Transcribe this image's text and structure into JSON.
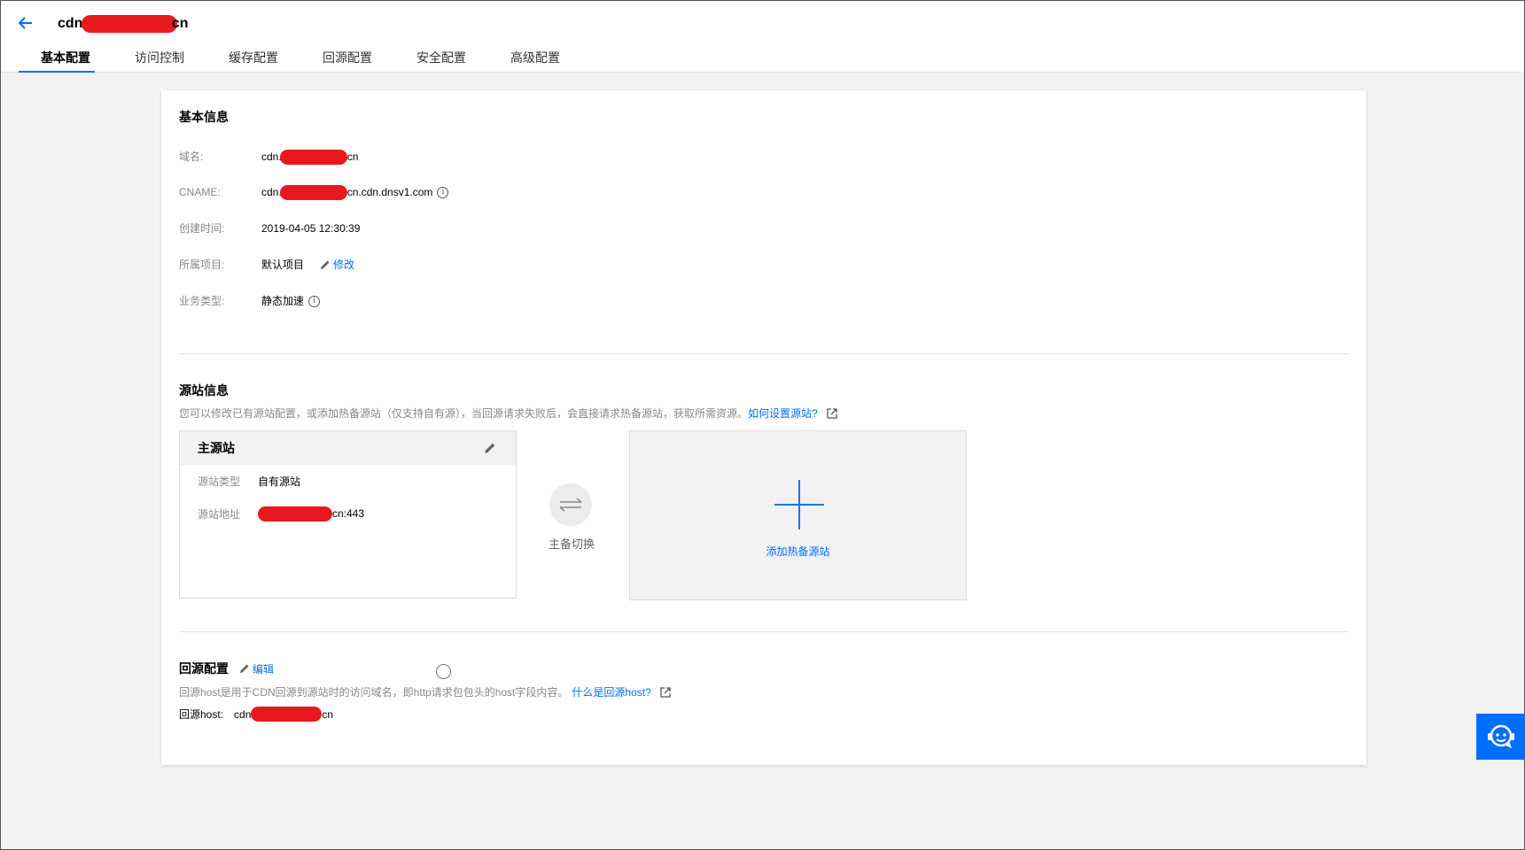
{
  "header": {
    "domain_prefix": "cdn.",
    "domain_suffix": "cn"
  },
  "tabs": [
    {
      "label": "基本配置",
      "active": true
    },
    {
      "label": "访问控制"
    },
    {
      "label": "缓存配置"
    },
    {
      "label": "回源配置"
    },
    {
      "label": "安全配置"
    },
    {
      "label": "高级配置"
    }
  ],
  "basic_info": {
    "title": "基本信息",
    "domain_label": "域名:",
    "domain_prefix": "cdn.",
    "domain_suffix": "cn",
    "cname_label": "CNAME:",
    "cname_prefix": "cdn.",
    "cname_suffix": "cn.cdn.dnsv1.com",
    "created_label": "创建时间:",
    "created_value": "2019-04-05 12:30:39",
    "project_label": "所属项目:",
    "project_value": "默认项目",
    "project_edit": "修改",
    "biz_label": "业务类型:",
    "biz_value": "静态加速"
  },
  "origin_info": {
    "title": "源站信息",
    "desc": "您可以修改已有源站配置，或添加热备源站（仅支持自有源），当回源请求失败后，会直接请求热备源站，获取所需资源。",
    "help_link": "如何设置源站?",
    "primary": {
      "title": "主源站",
      "type_label": "源站类型",
      "type_value": "自有源站",
      "addr_label": "源站地址",
      "addr_suffix": "cn:443"
    },
    "switch_label": "主备切换",
    "add_backup": "添加热备源站"
  },
  "back_to_origin": {
    "title": "回源配置",
    "edit": "编辑",
    "desc": "回源host是用于CDN回源到源站时的访问域名，即http请求包包头的host字段内容。",
    "help_link": "什么是回源host?",
    "host_label": "回源host:",
    "host_prefix": "cdn",
    "host_suffix": "cn"
  },
  "colors": {
    "accent": "#006eff",
    "redaction": "#e8191e",
    "background": "#f2f2f2"
  }
}
